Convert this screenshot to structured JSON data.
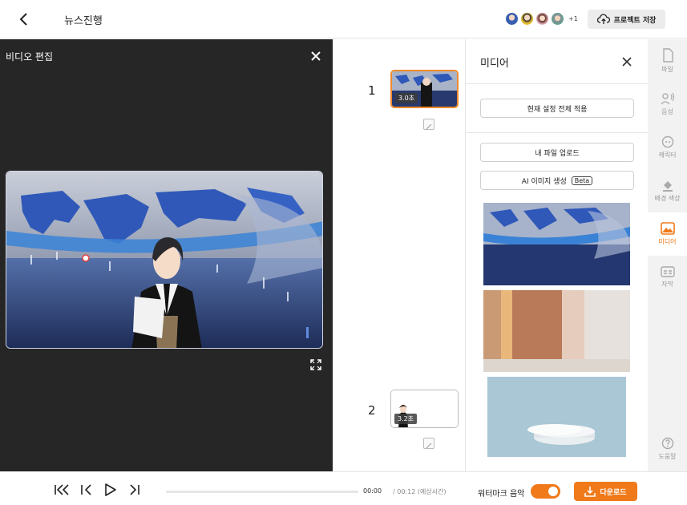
{
  "header": {
    "title": "뉴스진행",
    "avatars_more": "+1",
    "save_label": "프로젝트 저장"
  },
  "editor": {
    "title": "비디오 편집"
  },
  "timeline": {
    "scenes": [
      {
        "number": "1",
        "duration": "3.0초"
      },
      {
        "number": "2",
        "duration": "3.2초"
      }
    ]
  },
  "media_panel": {
    "title": "미디어",
    "apply_all_label": "현재 설정 전체 적용",
    "upload_label": "내 파일 업로드",
    "ai_image_label": "AI 이미지 생성",
    "beta_label": "Beta"
  },
  "sidebar": {
    "items": [
      {
        "label": "파일",
        "icon": "file-icon"
      },
      {
        "label": "음성",
        "icon": "voice-icon"
      },
      {
        "label": "캐릭터",
        "icon": "character-icon"
      },
      {
        "label": "배경 색상",
        "icon": "paint-bucket-icon"
      },
      {
        "label": "미디어",
        "icon": "image-icon",
        "active": true
      },
      {
        "label": "자막",
        "icon": "caption-icon"
      },
      {
        "label": "도움말",
        "icon": "help-icon"
      }
    ]
  },
  "player": {
    "current_time": "00:00",
    "total_time": "/ 00:12 (예상시간)",
    "progress": 0,
    "watermark_label": "워터마크 음악",
    "watermark_on": true,
    "download_label": "다운로드"
  },
  "colors": {
    "accent": "#f07a1a",
    "editor_bg": "#262626",
    "sidebar_bg": "#f2f2f2"
  }
}
